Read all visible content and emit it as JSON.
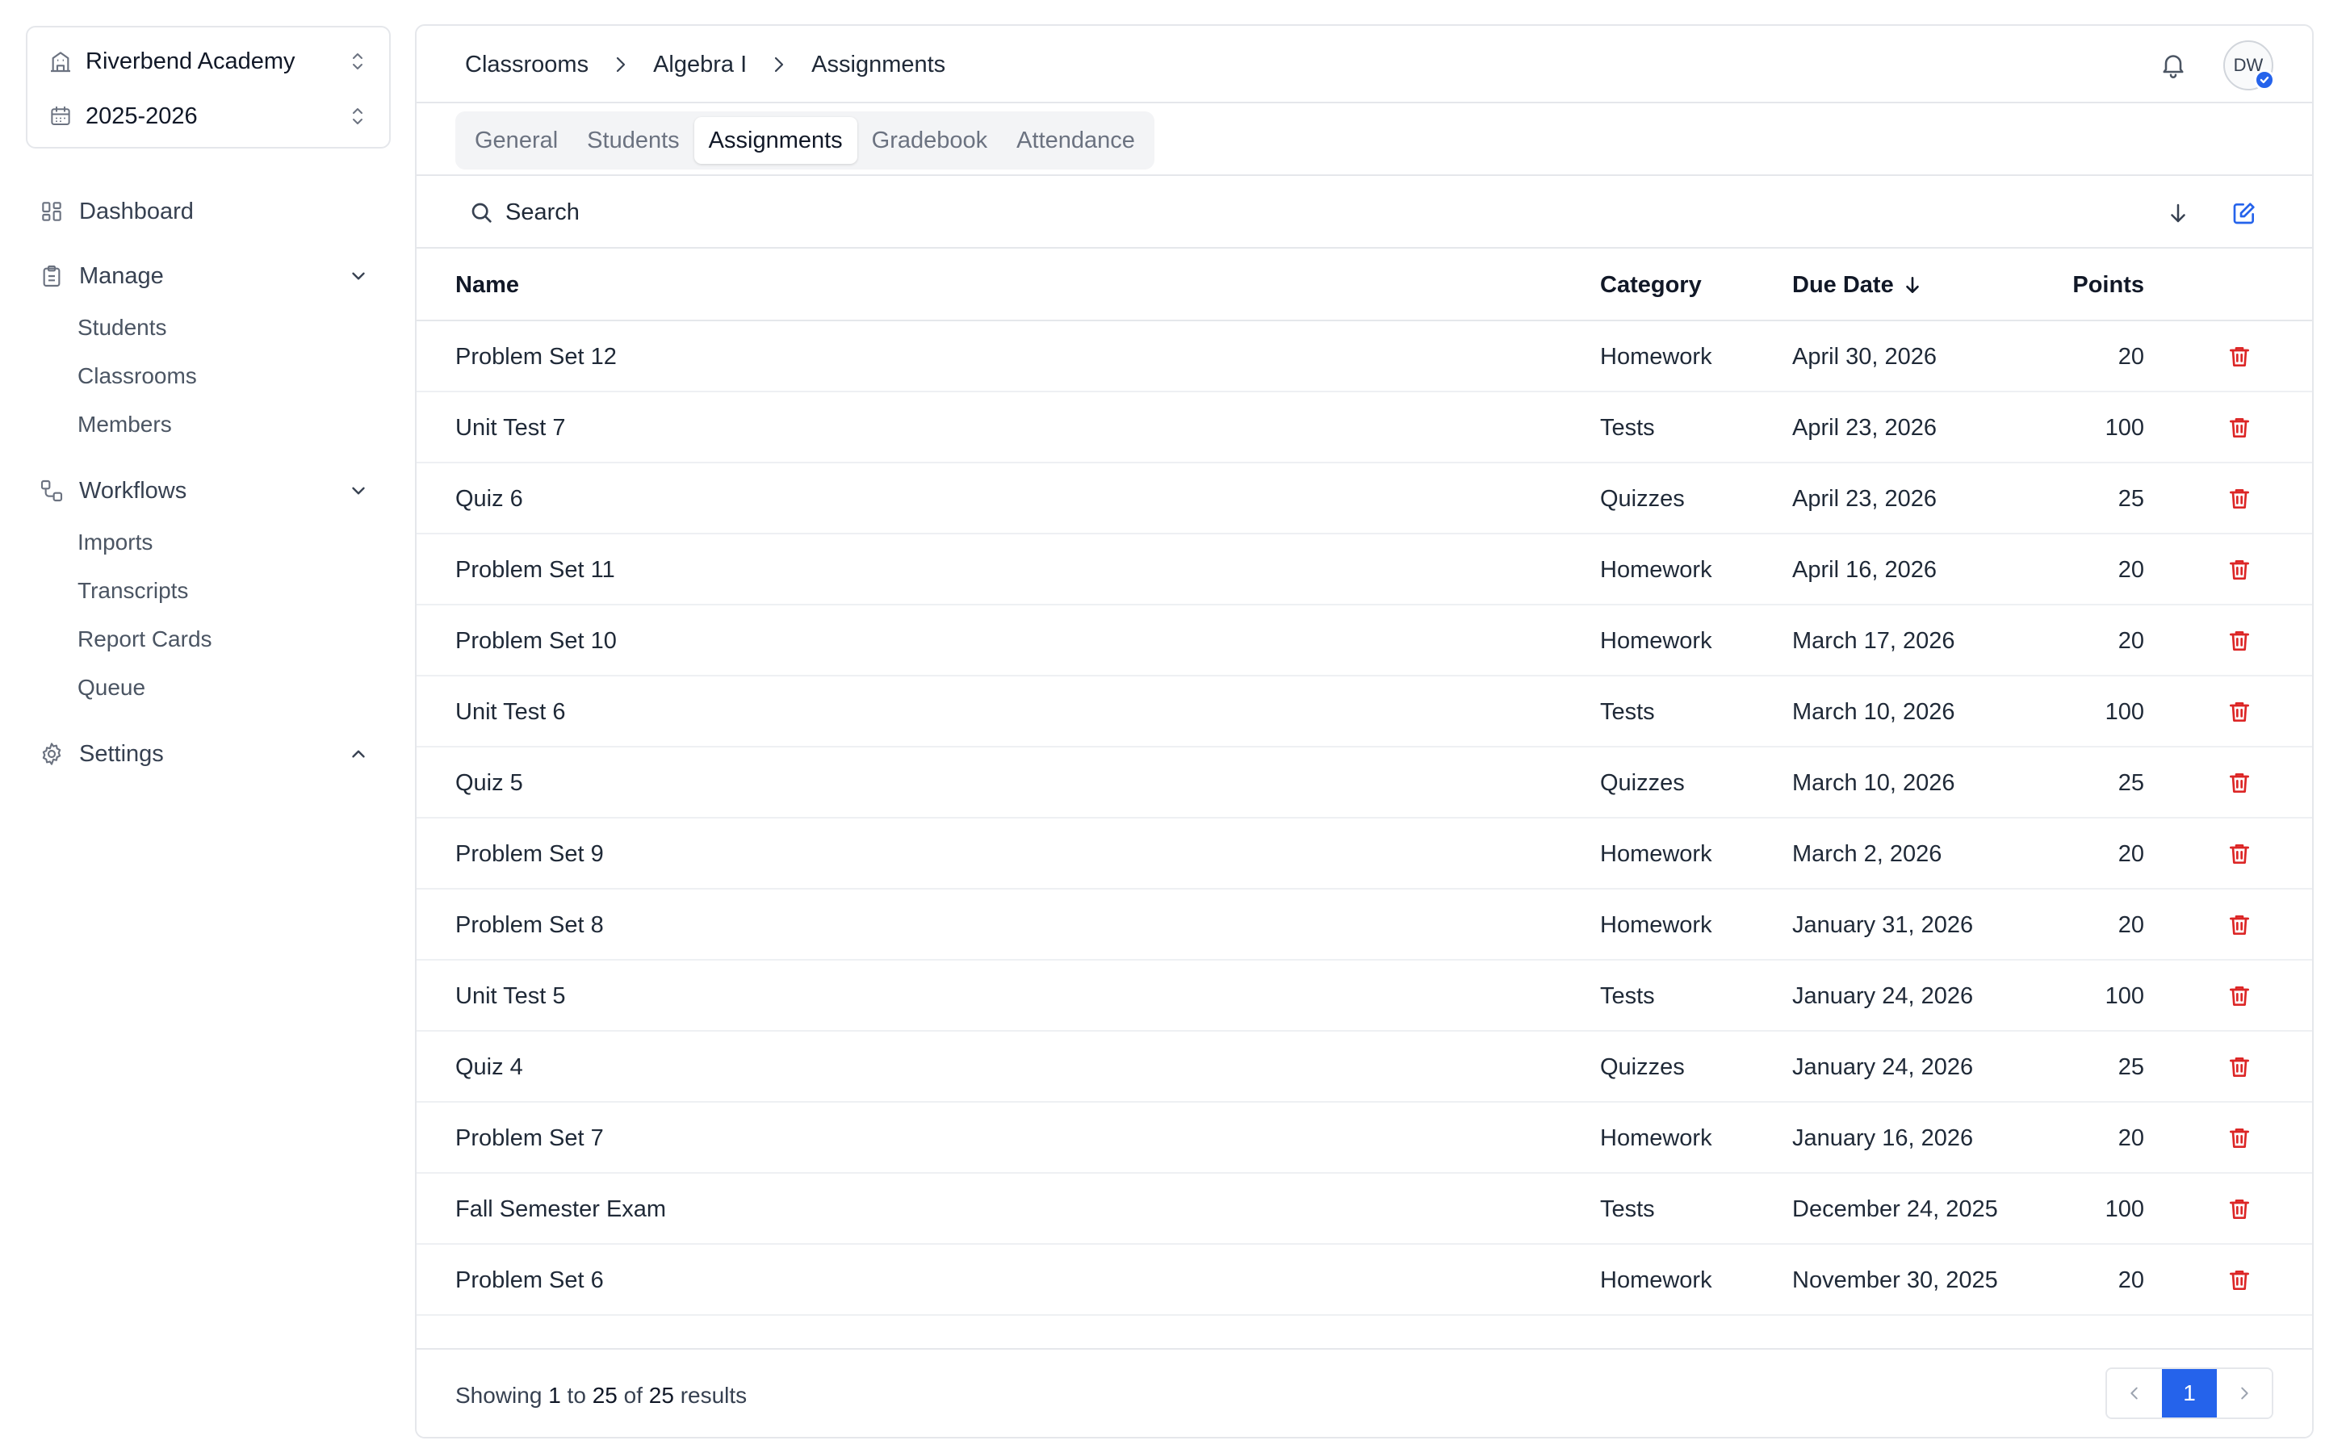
{
  "org": {
    "name": "Riverbend Academy",
    "year": "2025-2026"
  },
  "nav": {
    "dashboard": "Dashboard",
    "manage": {
      "label": "Manage",
      "items": [
        "Students",
        "Classrooms",
        "Members"
      ]
    },
    "workflows": {
      "label": "Workflows",
      "items": [
        "Imports",
        "Transcripts",
        "Report Cards",
        "Queue"
      ]
    },
    "settings": "Settings"
  },
  "breadcrumb": [
    "Classrooms",
    "Algebra I",
    "Assignments"
  ],
  "user": {
    "initials": "DW"
  },
  "tabs": [
    {
      "label": "General",
      "active": false
    },
    {
      "label": "Students",
      "active": false
    },
    {
      "label": "Assignments",
      "active": true
    },
    {
      "label": "Gradebook",
      "active": false
    },
    {
      "label": "Attendance",
      "active": false
    }
  ],
  "search": {
    "placeholder": "Search"
  },
  "table": {
    "headers": {
      "name": "Name",
      "category": "Category",
      "due": "Due Date",
      "points": "Points"
    },
    "rows": [
      {
        "name": "Problem Set 12",
        "category": "Homework",
        "due": "April 30, 2026",
        "points": "20"
      },
      {
        "name": "Unit Test 7",
        "category": "Tests",
        "due": "April 23, 2026",
        "points": "100"
      },
      {
        "name": "Quiz 6",
        "category": "Quizzes",
        "due": "April 23, 2026",
        "points": "25"
      },
      {
        "name": "Problem Set 11",
        "category": "Homework",
        "due": "April 16, 2026",
        "points": "20"
      },
      {
        "name": "Problem Set 10",
        "category": "Homework",
        "due": "March 17, 2026",
        "points": "20"
      },
      {
        "name": "Unit Test 6",
        "category": "Tests",
        "due": "March 10, 2026",
        "points": "100"
      },
      {
        "name": "Quiz 5",
        "category": "Quizzes",
        "due": "March 10, 2026",
        "points": "25"
      },
      {
        "name": "Problem Set 9",
        "category": "Homework",
        "due": "March 2, 2026",
        "points": "20"
      },
      {
        "name": "Problem Set 8",
        "category": "Homework",
        "due": "January 31, 2026",
        "points": "20"
      },
      {
        "name": "Unit Test 5",
        "category": "Tests",
        "due": "January 24, 2026",
        "points": "100"
      },
      {
        "name": "Quiz 4",
        "category": "Quizzes",
        "due": "January 24, 2026",
        "points": "25"
      },
      {
        "name": "Problem Set 7",
        "category": "Homework",
        "due": "January 16, 2026",
        "points": "20"
      },
      {
        "name": "Fall Semester Exam",
        "category": "Tests",
        "due": "December 24, 2025",
        "points": "100"
      },
      {
        "name": "Problem Set 6",
        "category": "Homework",
        "due": "November 30, 2025",
        "points": "20"
      }
    ]
  },
  "footer": {
    "prefix": "Showing",
    "from": "1",
    "to_word": "to",
    "to": "25",
    "of_word": "of",
    "total": "25",
    "suffix": "results"
  },
  "pagination": {
    "current": "1"
  },
  "colors": {
    "accent": "#2563eb",
    "danger": "#dc2626"
  }
}
